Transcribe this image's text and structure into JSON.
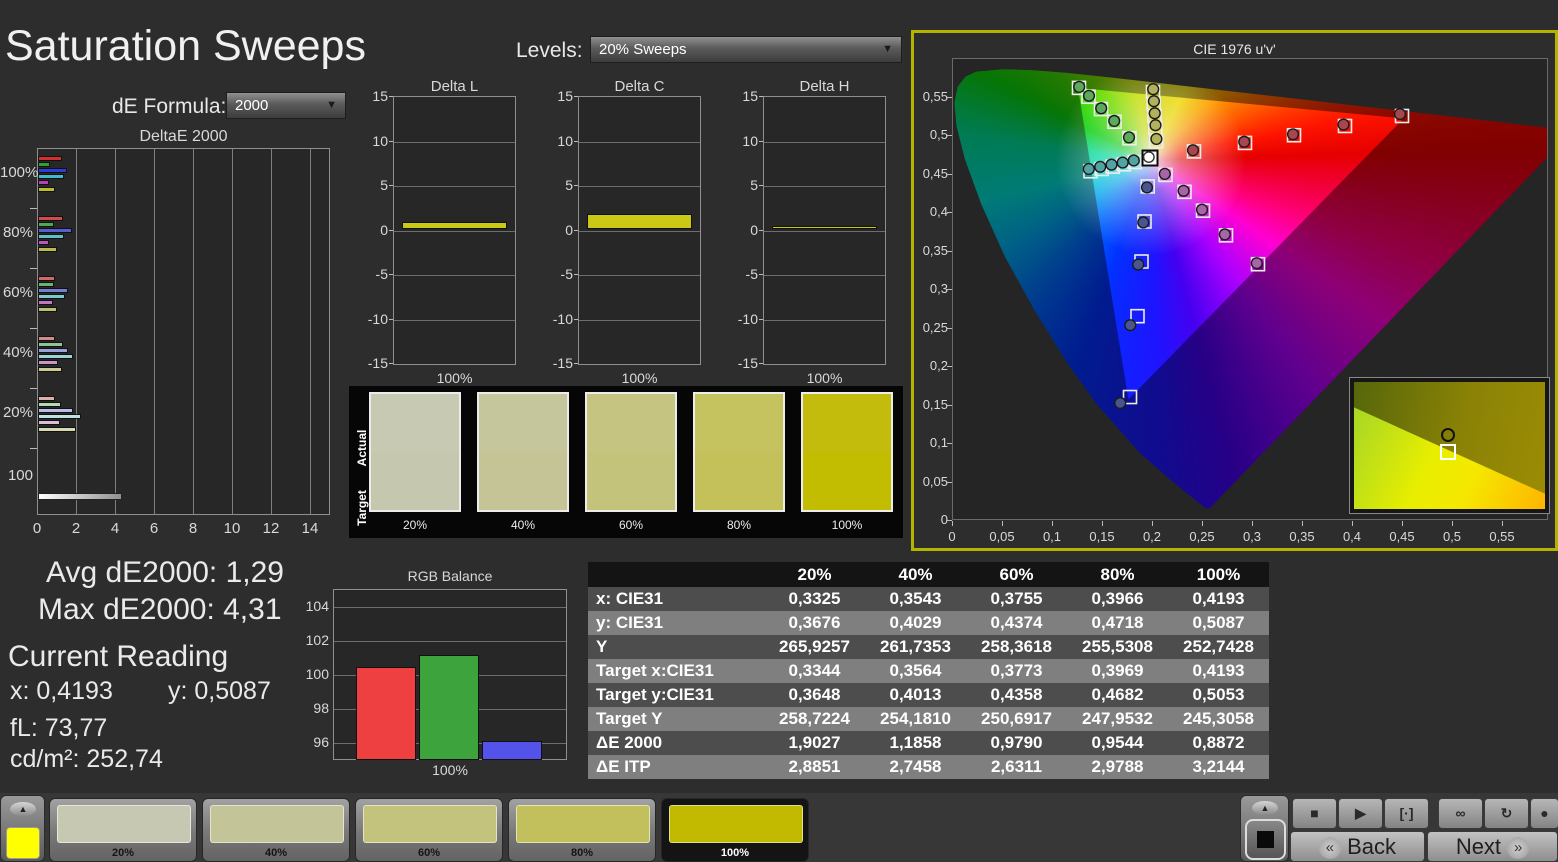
{
  "title": "Saturation Sweeps",
  "controls": {
    "de_formula_label": "dE Formula:",
    "de_formula_value": "2000",
    "levels_label": "Levels:",
    "levels_value": "20% Sweeps"
  },
  "stats": {
    "avg": "Avg dE2000: 1,29",
    "max": "Max dE2000: 4,31",
    "current_reading": "Current Reading",
    "x": "x: 0,4193",
    "y": "y: 0,5087",
    "fl": "fL: 73,77",
    "cdm2": "cd/m²: 252,74"
  },
  "chart_data": [
    {
      "id": "deltae2000",
      "type": "bar",
      "title": "DeltaE 2000",
      "orientation": "horizontal",
      "xlim": [
        0,
        15
      ],
      "xticks": [
        0,
        2,
        4,
        6,
        8,
        10,
        12,
        14
      ],
      "series": [
        "Red",
        "Green",
        "Blue",
        "Cyan",
        "Magenta",
        "Yellow"
      ],
      "groups": [
        {
          "label": "100%",
          "values": [
            1.25,
            0.63,
            1.5,
            1.33,
            0.58,
            0.88
          ],
          "colors": [
            "#d42f2f",
            "#2fa32f",
            "#2f3fd4",
            "#3fbacf",
            "#bb3fbb",
            "#bcbc2f"
          ]
        },
        {
          "label": "80%",
          "values": [
            1.3,
            0.83,
            1.72,
            1.34,
            0.55,
            0.97
          ],
          "colors": [
            "#d14b4b",
            "#4ea84e",
            "#5560d0",
            "#5fc0ca",
            "#b857b8",
            "#b9b950"
          ]
        },
        {
          "label": "60%",
          "values": [
            0.88,
            0.8,
            1.56,
            1.39,
            0.75,
            0.97
          ],
          "colors": [
            "#cf6868",
            "#6db36d",
            "#7381d2",
            "#7ccaca",
            "#bf78bf",
            "#bfbf73"
          ]
        },
        {
          "label": "40%",
          "values": [
            0.88,
            1.26,
            1.55,
            1.77,
            1.04,
            1.22
          ],
          "colors": [
            "#d28a8a",
            "#90c590",
            "#98a3da",
            "#9bd4d4",
            "#c796c7",
            "#cbcb93"
          ]
        },
        {
          "label": "20%",
          "values": [
            0.88,
            1.2,
            1.77,
            2.19,
            1.14,
            1.94
          ],
          "colors": [
            "#dcb0b0",
            "#b6d9af",
            "#b8bde5",
            "#bfe1e1",
            "#d9bdd9",
            "#d9d9b3"
          ]
        },
        {
          "label": "100",
          "values": [
            4.31
          ],
          "colors": [
            "#ffffff"
          ],
          "white": true
        }
      ]
    },
    {
      "id": "delta_l",
      "type": "bar",
      "title": "Delta L",
      "ylim": [
        -15,
        15
      ],
      "yticks": [
        15,
        10,
        5,
        0,
        -5,
        -10,
        -15
      ],
      "categories": [
        "100%"
      ],
      "values": [
        0.8
      ],
      "bar_color": "#c9c916"
    },
    {
      "id": "delta_c",
      "type": "bar",
      "title": "Delta C",
      "ylim": [
        -15,
        15
      ],
      "yticks": [
        15,
        10,
        5,
        0,
        -5,
        -10,
        -15
      ],
      "categories": [
        "100%"
      ],
      "values": [
        1.7
      ],
      "bar_color": "#c9c916"
    },
    {
      "id": "delta_h",
      "type": "bar",
      "title": "Delta H",
      "ylim": [
        -15,
        15
      ],
      "yticks": [
        15,
        10,
        5,
        0,
        -5,
        -10,
        -15
      ],
      "categories": [
        "100%"
      ],
      "values": [
        0.4
      ],
      "bar_color": "#c9c916"
    },
    {
      "id": "cie",
      "type": "scatter",
      "title": "CIE 1976 u'v'",
      "xlim": [
        0,
        0.6
      ],
      "ylim": [
        0,
        0.6
      ],
      "xtick_labels": [
        "0",
        "0,05",
        "0,1",
        "0,15",
        "0,2",
        "0,25",
        "0,3",
        "0,35",
        "0,4",
        "0,45",
        "0,5",
        "0,55"
      ],
      "ytick_labels": [
        "0",
        "0,05",
        "0,1",
        "0,15",
        "0,2",
        "0,25",
        "0,3",
        "0,35",
        "0,4",
        "0,45",
        "0,5",
        "0,55"
      ],
      "gamut_triangle": {
        "red": [
          0.4507,
          0.5229
        ],
        "green": [
          0.125,
          0.5625
        ],
        "blue": [
          0.1754,
          0.1579
        ]
      },
      "white_point": {
        "target": [
          0.197,
          0.4714
        ],
        "measured": [
          0.1958,
          0.4726
        ]
      },
      "sweeps": [
        {
          "name": "red",
          "marker_color": "#a6464e",
          "targets": [
            [
              0.241,
              0.48
            ],
            [
              0.292,
              0.491
            ],
            [
              0.341,
              0.501
            ],
            [
              0.392,
              0.513
            ],
            [
              0.449,
              0.526
            ]
          ],
          "measured": [
            [
              0.24,
              0.4815
            ],
            [
              0.2912,
              0.4925
            ],
            [
              0.34,
              0.5022
            ],
            [
              0.3905,
              0.5148
            ],
            [
              0.447,
              0.5285
            ]
          ]
        },
        {
          "name": "green",
          "marker_color": "#5ca85c",
          "targets": [
            [
              0.1765,
              0.497
            ],
            [
              0.1615,
              0.5185
            ],
            [
              0.148,
              0.535
            ],
            [
              0.1355,
              0.551
            ],
            [
              0.126,
              0.5625
            ]
          ],
          "measured": [
            [
              0.176,
              0.4982
            ],
            [
              0.1612,
              0.5196
            ],
            [
              0.1482,
              0.536
            ],
            [
              0.136,
              0.5522
            ],
            [
              0.1262,
              0.5638
            ]
          ]
        },
        {
          "name": "blue",
          "marker_color": "#49568e",
          "targets": [
            [
              0.1947,
              0.4345
            ],
            [
              0.1915,
              0.389
            ],
            [
              0.1885,
              0.337
            ],
            [
              0.1845,
              0.266
            ],
            [
              0.177,
              0.161
            ]
          ],
          "measured": [
            [
              0.194,
              0.4332
            ],
            [
              0.1903,
              0.3878
            ],
            [
              0.1852,
              0.333
            ],
            [
              0.1773,
              0.2543
            ],
            [
              0.1672,
              0.1532
            ]
          ]
        },
        {
          "name": "cyan",
          "marker_color": "#52a4a4",
          "targets": [
            [
              0.1818,
              0.4662
            ],
            [
              0.1708,
              0.4632
            ],
            [
              0.1598,
              0.4602
            ],
            [
              0.1487,
              0.4572
            ],
            [
              0.1375,
              0.4542
            ]
          ],
          "measured": [
            [
              0.1808,
              0.4682
            ],
            [
              0.1697,
              0.4655
            ],
            [
              0.1585,
              0.4628
            ],
            [
              0.1472,
              0.46
            ],
            [
              0.1358,
              0.4572
            ]
          ]
        },
        {
          "name": "magenta",
          "marker_color": "#a864a8",
          "targets": [
            [
              0.2125,
              0.4495
            ],
            [
              0.2315,
              0.4275
            ],
            [
              0.25,
              0.403
            ],
            [
              0.273,
              0.371
            ],
            [
              0.305,
              0.3335
            ]
          ],
          "measured": [
            [
              0.2118,
              0.4508
            ],
            [
              0.2306,
              0.4288
            ],
            [
              0.249,
              0.4043
            ],
            [
              0.2718,
              0.3722
            ],
            [
              0.3038,
              0.3348
            ]
          ]
        },
        {
          "name": "yellow",
          "marker_color": "#b2b25e",
          "targets": [
            [
              0.2032,
              0.4932
            ],
            [
              0.2023,
              0.5105
            ],
            [
              0.2015,
              0.5262
            ],
            [
              0.2007,
              0.5415
            ],
            [
              0.2,
              0.557
            ]
          ],
          "measured": [
            [
              0.2034,
              0.4962
            ],
            [
              0.2025,
              0.514
            ],
            [
              0.2017,
              0.5295
            ],
            [
              0.2009,
              0.5452
            ],
            [
              0.2002,
              0.5608
            ]
          ]
        }
      ],
      "inset_markers": {
        "circle": [
          0.49,
          0.42
        ],
        "square": [
          0.49,
          0.55
        ]
      }
    },
    {
      "id": "rgb_balance",
      "type": "bar",
      "title": "RGB Balance",
      "categories": [
        "Red",
        "Green",
        "Blue"
      ],
      "values": [
        100.5,
        101.2,
        96.1
      ],
      "ylim": [
        95,
        105
      ],
      "yticks": [
        104,
        102,
        100,
        98,
        96
      ],
      "xlabel": "100%",
      "colors": [
        "#ee4040",
        "#3da43d",
        "#5353ea"
      ]
    },
    {
      "id": "measurement_table",
      "type": "table",
      "col_headers": [
        "20%",
        "40%",
        "60%",
        "80%",
        "100%"
      ],
      "rows": [
        {
          "label": "x: CIE31",
          "values": [
            "0,3325",
            "0,3543",
            "0,3755",
            "0,3966",
            "0,4193"
          ]
        },
        {
          "label": "y: CIE31",
          "values": [
            "0,3676",
            "0,4029",
            "0,4374",
            "0,4718",
            "0,5087"
          ]
        },
        {
          "label": "Y",
          "values": [
            "265,9257",
            "261,7353",
            "258,3618",
            "255,5308",
            "252,7428"
          ]
        },
        {
          "label": "Target x:CIE31",
          "values": [
            "0,3344",
            "0,3564",
            "0,3773",
            "0,3969",
            "0,4193"
          ]
        },
        {
          "label": "Target y:CIE31",
          "values": [
            "0,3648",
            "0,4013",
            "0,4358",
            "0,4682",
            "0,5053"
          ]
        },
        {
          "label": "Target Y",
          "values": [
            "258,7224",
            "254,1810",
            "250,6917",
            "247,9532",
            "245,3058"
          ]
        },
        {
          "label": "ΔE 2000",
          "values": [
            "1,9027",
            "1,1858",
            "0,9790",
            "0,9544",
            "0,8872"
          ]
        },
        {
          "label": "ΔE ITP",
          "values": [
            "2,8851",
            "2,7458",
            "2,6311",
            "2,9788",
            "3,2144"
          ]
        }
      ]
    },
    {
      "id": "swatch_compare",
      "type": "swatch-comparison",
      "row_labels": [
        "Actual",
        "Target"
      ],
      "levels": [
        "20%",
        "40%",
        "60%",
        "80%",
        "100%"
      ],
      "actual_colors": [
        "#c7c9b3",
        "#c6c69c",
        "#c5c480",
        "#c5c260",
        "#c3bc0d"
      ],
      "target_colors": [
        "#c5c7ae",
        "#c4c497",
        "#c4c37b",
        "#c4c15b",
        "#c2bd00"
      ]
    }
  ],
  "bottom_bar": {
    "current_color": "#ffff00",
    "swatches": [
      {
        "label": "20%",
        "color": "#c6c8b1",
        "selected": false
      },
      {
        "label": "40%",
        "color": "#c4c499",
        "selected": false
      },
      {
        "label": "60%",
        "color": "#c3c37d",
        "selected": false
      },
      {
        "label": "80%",
        "color": "#c2c05d",
        "selected": false
      },
      {
        "label": "100%",
        "color": "#c1ba00",
        "selected": true
      }
    ],
    "back_label": "Back",
    "next_label": "Next"
  }
}
